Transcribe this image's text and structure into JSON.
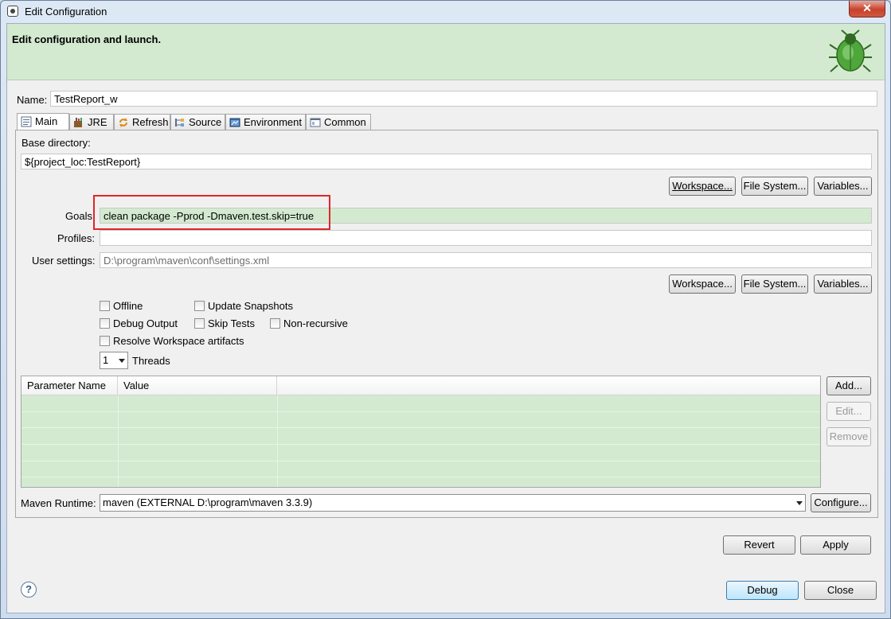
{
  "window": {
    "title": "Edit Configuration",
    "close_glyph": "✕"
  },
  "banner": {
    "heading": "Edit configuration and launch.",
    "icon": "debug-bug-icon"
  },
  "name": {
    "label": "Name:",
    "value": "TestReport_w"
  },
  "tabs": [
    {
      "label": "Main",
      "icon": "main-tab-icon",
      "active": true
    },
    {
      "label": "JRE",
      "icon": "jre-icon",
      "active": false
    },
    {
      "label": "Refresh",
      "icon": "refresh-icon",
      "active": false
    },
    {
      "label": "Source",
      "icon": "source-icon",
      "active": false
    },
    {
      "label": "Environment",
      "icon": "environment-icon",
      "active": false
    },
    {
      "label": "Common",
      "icon": "common-icon",
      "active": false
    }
  ],
  "main": {
    "base_dir_label": "Base directory:",
    "base_dir_value": "${project_loc:TestReport}",
    "workspace_btn": "Workspace...",
    "filesystem_btn": "File System...",
    "variables_btn": "Variables...",
    "goals_label": "Goals",
    "goals_value": "clean package -Pprod -Dmaven.test.skip=true",
    "profiles_label": "Profiles:",
    "profiles_value": "",
    "user_settings_label": "User settings:",
    "user_settings_value": "D:\\program\\maven\\conf\\settings.xml",
    "checkboxes": {
      "offline": "Offline",
      "update_snapshots": "Update Snapshots",
      "debug_output": "Debug Output",
      "skip_tests": "Skip Tests",
      "non_recursive": "Non-recursive",
      "resolve_workspace": "Resolve Workspace artifacts"
    },
    "threads_value": "1",
    "threads_label": "Threads",
    "table": {
      "col_name": "Parameter Name",
      "col_value": "Value"
    },
    "add_btn": "Add...",
    "edit_btn": "Edit...",
    "remove_btn": "Remove",
    "runtime_label": "Maven Runtime:",
    "runtime_value": "maven (EXTERNAL D:\\program\\maven 3.3.9)",
    "configure_btn": "Configure..."
  },
  "footer": {
    "revert_btn": "Revert",
    "apply_btn": "Apply",
    "debug_btn": "Debug",
    "close_btn": "Close",
    "help_glyph": "?"
  },
  "colors": {
    "banner": "#d3ead0",
    "highlight_box": "#e0262a",
    "table_rows": "#d3ead0"
  }
}
